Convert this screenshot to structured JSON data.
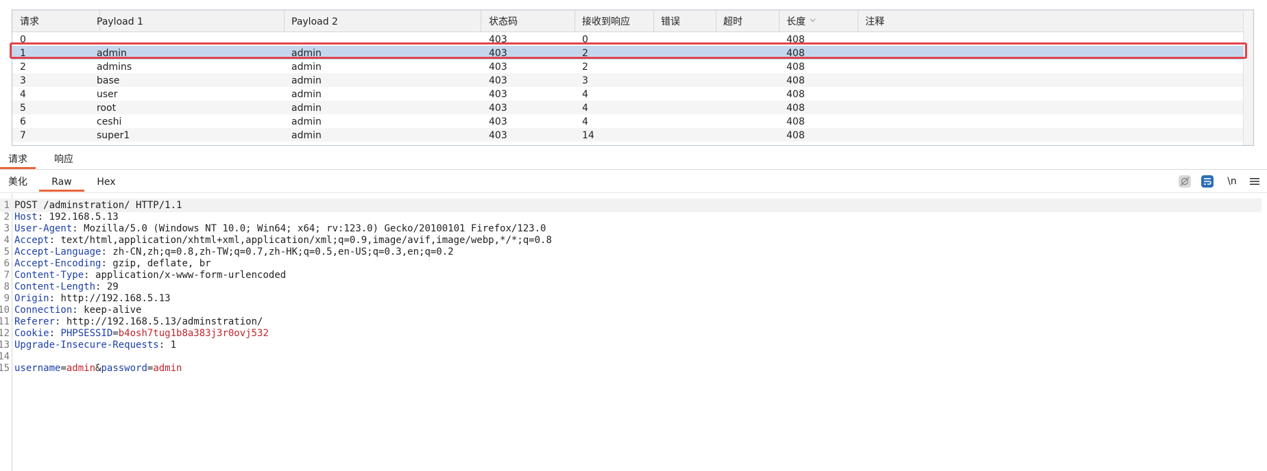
{
  "results_table": {
    "columns": [
      {
        "label": "请求"
      },
      {
        "label": "Payload 1"
      },
      {
        "label": "Payload 2"
      },
      {
        "label": "状态码"
      },
      {
        "label": "接收到响应"
      },
      {
        "label": "错误"
      },
      {
        "label": "超时"
      },
      {
        "label": "长度"
      },
      {
        "label": "注释"
      }
    ],
    "sorted_column": "长度",
    "rows": [
      {
        "request": "0",
        "payload1": "",
        "payload2": "",
        "status": "403",
        "received": "0",
        "error": "",
        "timeout": "",
        "length": "408",
        "comment": ""
      },
      {
        "request": "1",
        "payload1": "admin",
        "payload2": "admin",
        "status": "403",
        "received": "2",
        "error": "",
        "timeout": "",
        "length": "408",
        "comment": ""
      },
      {
        "request": "2",
        "payload1": "admins",
        "payload2": "admin",
        "status": "403",
        "received": "2",
        "error": "",
        "timeout": "",
        "length": "408",
        "comment": ""
      },
      {
        "request": "3",
        "payload1": "base",
        "payload2": "admin",
        "status": "403",
        "received": "3",
        "error": "",
        "timeout": "",
        "length": "408",
        "comment": ""
      },
      {
        "request": "4",
        "payload1": "user",
        "payload2": "admin",
        "status": "403",
        "received": "4",
        "error": "",
        "timeout": "",
        "length": "408",
        "comment": ""
      },
      {
        "request": "5",
        "payload1": "root",
        "payload2": "admin",
        "status": "403",
        "received": "4",
        "error": "",
        "timeout": "",
        "length": "408",
        "comment": ""
      },
      {
        "request": "6",
        "payload1": "ceshi",
        "payload2": "admin",
        "status": "403",
        "received": "4",
        "error": "",
        "timeout": "",
        "length": "408",
        "comment": ""
      },
      {
        "request": "7",
        "payload1": "super1",
        "payload2": "admin",
        "status": "403",
        "received": "14",
        "error": "",
        "timeout": "",
        "length": "408",
        "comment": ""
      }
    ],
    "selected_row": "1"
  },
  "main_tabs": [
    {
      "label": "请求",
      "active": true
    },
    {
      "label": "响应",
      "active": false
    }
  ],
  "view_tabs": [
    {
      "label": "美化",
      "active": false
    },
    {
      "label": "Raw",
      "active": true
    },
    {
      "label": "Hex",
      "active": false
    }
  ],
  "toolbar": {
    "newline_label": "\\n",
    "icons": [
      "hide-nonprinting-icon",
      "word-wrap-icon",
      "newline-toggle-icon",
      "menu-icon"
    ],
    "accent_color": "#2f6db5"
  },
  "request": {
    "lines": [
      {
        "n": "1",
        "plain": "POST /adminstration/ HTTP/1.1"
      },
      {
        "n": "2",
        "key": "Host",
        "value": " 192.168.5.13"
      },
      {
        "n": "3",
        "key": "User-Agent",
        "value": " Mozilla/5.0 (Windows NT 10.0; Win64; x64; rv:123.0) Gecko/20100101 Firefox/123.0"
      },
      {
        "n": "4",
        "key": "Accept",
        "value": " text/html,application/xhtml+xml,application/xml;q=0.9,image/avif,image/webp,*/*;q=0.8"
      },
      {
        "n": "5",
        "key": "Accept-Language",
        "value": " zh-CN,zh;q=0.8,zh-TW;q=0.7,zh-HK;q=0.5,en-US;q=0.3,en;q=0.2"
      },
      {
        "n": "6",
        "key": "Accept-Encoding",
        "value": " gzip, deflate, br"
      },
      {
        "n": "7",
        "key": "Content-Type",
        "value": " application/x-www-form-urlencoded"
      },
      {
        "n": "8",
        "key": "Content-Length",
        "value": " 29"
      },
      {
        "n": "9",
        "key": "Origin",
        "value": " http://192.168.5.13"
      },
      {
        "n": "10",
        "key": "Connection",
        "value": " keep-alive"
      },
      {
        "n": "11",
        "key": "Referer",
        "value": " http://192.168.5.13/adminstration/"
      },
      {
        "n": "12",
        "key": "Cookie",
        "cookie_name": "PHPSESSID",
        "cookie_value": "b4osh7tug1b8a383j3r0ovj532"
      },
      {
        "n": "13",
        "key": "Upgrade-Insecure-Requests",
        "value": " 1"
      },
      {
        "n": "14",
        "plain": ""
      },
      {
        "n": "15",
        "body": [
          {
            "k": "username"
          },
          {
            "op": "="
          },
          {
            "v": "admin"
          },
          {
            "op": "&"
          },
          {
            "k": "password"
          },
          {
            "op": "="
          },
          {
            "v": "admin"
          }
        ]
      }
    ]
  },
  "colors": {
    "header_key": "#1c3fa8",
    "param_value": "#c0262d",
    "selection_border": "#e2434d",
    "selected_row": "#c5d7ed",
    "tab_underline": "#e8643a"
  }
}
